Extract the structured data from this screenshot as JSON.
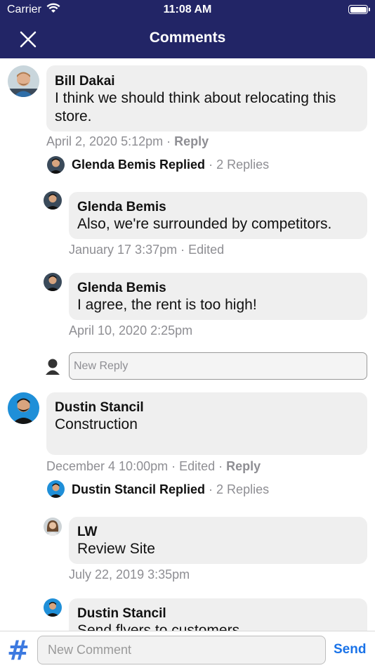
{
  "status": {
    "carrier": "Carrier",
    "time": "11:08 AM"
  },
  "nav": {
    "title": "Comments"
  },
  "comments": [
    {
      "author": "Bill Dakai",
      "text_line1": "I think we should think about relocating this",
      "text_line2": "store.",
      "timestamp": "April 2, 2020 5:12pm",
      "reply_label": "Reply",
      "replied_by": "Glenda Bemis Replied",
      "reply_count": "2 Replies",
      "replies": [
        {
          "author": "Glenda Bemis",
          "text": "Also, we're surrounded by competitors.",
          "timestamp": "January 17 3:37pm · Edited"
        },
        {
          "author": "Glenda Bemis",
          "text": "I agree, the rent is too high!",
          "timestamp": "April 10, 2020 2:25pm"
        }
      ],
      "new_reply_placeholder": "New Reply"
    },
    {
      "author": "Dustin Stancil",
      "text": "Construction",
      "timestamp": "December 4 10:00pm · Edited",
      "reply_label": "Reply",
      "replied_by": "Dustin Stancil Replied",
      "reply_count": "2 Replies",
      "replies": [
        {
          "author": "LW",
          "text": "Review Site",
          "timestamp": "July 22, 2019 3:35pm"
        },
        {
          "author": "Dustin Stancil",
          "text": "Send flyers to customers"
        }
      ]
    }
  ],
  "bottom": {
    "hash": "#",
    "placeholder": "New Comment",
    "send_label": "Send"
  },
  "colors": {
    "nav_bg": "#222566",
    "accent": "#1a73e8",
    "bubble": "#efefef",
    "meta": "#8e8e93"
  }
}
